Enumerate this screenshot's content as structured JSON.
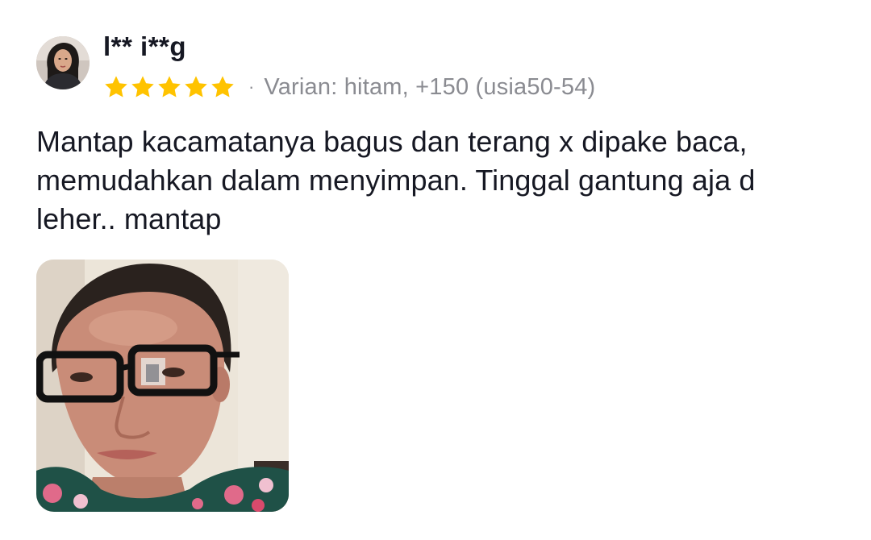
{
  "review": {
    "username": "l** i**g",
    "rating": 5,
    "rating_max": 5,
    "separator": "·",
    "variant": "Varian: hitam, +150 (usia50-54)",
    "text_lines": [
      "Mantap kacamatanya bagus dan terang x dipake baca,",
      "memudahkan dalam menyimpan. Tinggal gantung aja d",
      "leher.. mantap"
    ]
  },
  "colors": {
    "star": "#FFC300",
    "text": "#161823",
    "muted": "#8A8B91"
  },
  "icons": {
    "star": "star-icon"
  }
}
